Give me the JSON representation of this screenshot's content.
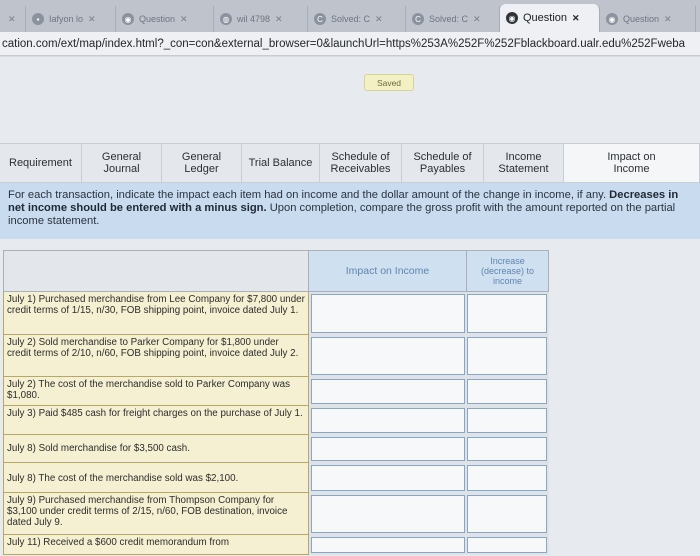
{
  "browser": {
    "tabs": [
      {
        "label": "Iafyon lo",
        "active": false
      },
      {
        "label": "Question",
        "active": false
      },
      {
        "label": "wil 4798",
        "active": false
      },
      {
        "label": "Solved: C",
        "active": false
      },
      {
        "label": "Solved: C",
        "active": false
      },
      {
        "label": "Question",
        "active": true
      },
      {
        "label": "Question",
        "active": false
      }
    ],
    "url": "cation.com/ext/map/index.html?_con=con&external_browser=0&launchUrl=https%253A%252F%252Fblackboard.ualr.edu%252Fweba"
  },
  "status": {
    "saved_label": "Saved"
  },
  "tabs": [
    {
      "label": "Requirement"
    },
    {
      "label": "General Journal"
    },
    {
      "label": "General Ledger"
    },
    {
      "label": "Trial Balance"
    },
    {
      "label": "Schedule of Receivables"
    },
    {
      "label": "Schedule of Payables"
    },
    {
      "label": "Income Statement"
    },
    {
      "label": "Impact on Income"
    }
  ],
  "instructions": {
    "line1": "For each transaction, indicate the impact each item had on income and the dollar amount of the change in income, if any.",
    "bold": "Decreases in net income should be entered with a minus sign.",
    "line2": " Upon completion, compare the gross profit with the amount reported on the partial income statement."
  },
  "table": {
    "headers": {
      "impact": "Impact on Income",
      "change": "Increase (decrease) to income"
    },
    "rows": [
      {
        "desc": "July 1) Purchased merchandise from Lee Company for $7,800 under credit terms of 1/15, n/30, FOB shipping point, invoice dated July 1."
      },
      {
        "desc": "July 2) Sold merchandise to Parker Company for $1,800 under credit terms of 2/10, n/60, FOB shipping point, invoice dated July 2."
      },
      {
        "desc": "July 2) The cost of the merchandise sold to Parker Company was $1,080."
      },
      {
        "desc": "July 3) Paid $485 cash for freight charges on the purchase of July 1."
      },
      {
        "desc": "July 8) Sold merchandise for $3,500 cash."
      },
      {
        "desc": "July 8) The cost of the merchandise sold was $2,100."
      },
      {
        "desc": "July 9) Purchased merchandise from Thompson Company for $3,100 under credit terms of 2/15, n/60, FOB destination, invoice dated July 9."
      },
      {
        "desc": "July 11) Received a $600 credit memorandum from"
      }
    ]
  }
}
